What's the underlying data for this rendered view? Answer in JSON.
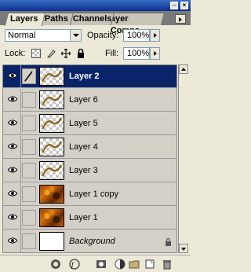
{
  "tabs": [
    "Layers",
    "Paths",
    "Channels",
    "ayer Comps"
  ],
  "blend_mode": "Normal",
  "opacity_label": "Opacity:",
  "opacity_value": "100%",
  "lock_label": "Lock:",
  "fill_label": "Fill:",
  "fill_value": "100%",
  "layers": [
    {
      "name": "Layer 2",
      "selected": true,
      "thumbnail": "stroke"
    },
    {
      "name": "Layer 6",
      "thumbnail": "stroke"
    },
    {
      "name": "Layer 5",
      "thumbnail": "stroke"
    },
    {
      "name": "Layer 4",
      "thumbnail": "stroke"
    },
    {
      "name": "Layer 3",
      "thumbnail": "stroke"
    },
    {
      "name": "Layer 1 copy",
      "thumbnail": "texture"
    },
    {
      "name": "Layer 1",
      "thumbnail": "texture"
    },
    {
      "name": "Background",
      "thumbnail": "white",
      "locked": true
    }
  ],
  "bottom_icons": [
    "link-layers-icon",
    "layer-style-icon",
    "layer-mask-icon",
    "new-group-icon",
    "adjustment-layer-icon",
    "new-layer-icon",
    "trash-icon"
  ],
  "colors": {
    "selection": "#0a246a",
    "panel": "#d4d0c8",
    "titlebar": "#0a2f8e"
  }
}
